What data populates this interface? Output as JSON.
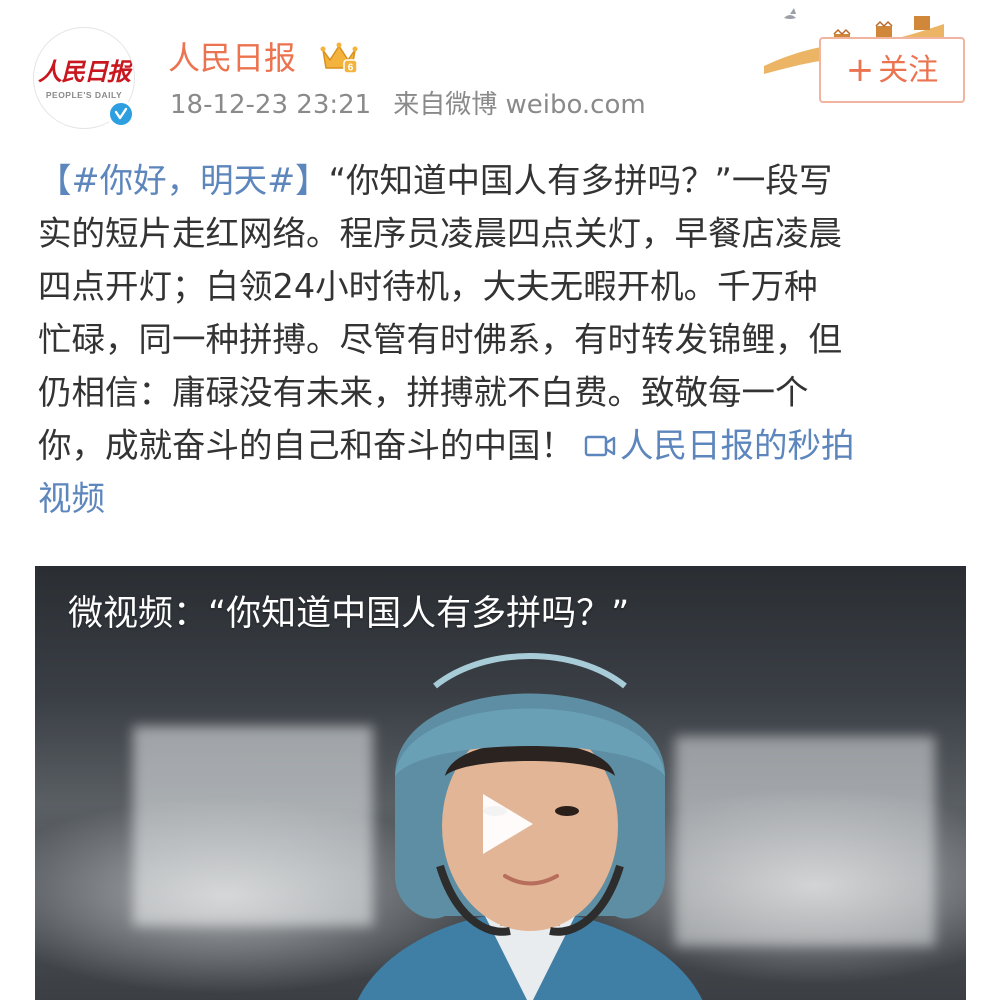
{
  "account": {
    "name": "人民日报",
    "avatar_logo_cn": "人民日报",
    "avatar_logo_en": "PEOPLE'S DAILY",
    "verified": true,
    "verified_color": "#2d9ee0",
    "member_icon": "crown-icon"
  },
  "post_meta": {
    "timestamp": "18-12-23 23:21",
    "source": "来自微博 weibo.com"
  },
  "follow_button": {
    "plus": "+",
    "label": "关注"
  },
  "post": {
    "hashtag": "【#你好，明天#】",
    "lines": [
      "“你知道中国人有多拼吗？”一段写",
      "实的短片走红网络。程序员凌晨四点关灯，早餐店凌晨",
      "四点开灯；白领24小时待机，大夫无暇开机。千万种",
      "忙碌，同一种拼搏。尽管有时佛系，有时转发锦鲤，但",
      "仍相信：庸碌没有未来，拼搏就不白费。致敬每一个",
      "你，成就奋斗的自己和奋斗的中国！"
    ],
    "video_link_part1": "人民日报的秒拍",
    "video_link_part2": "视频"
  },
  "video": {
    "title": "微视频：“你知道中国人有多拼吗？”",
    "play_icon": "play-icon"
  },
  "colors": {
    "username": "#eb7350",
    "link": "#5d86bd",
    "text": "#333333",
    "meta": "#8a8a8a"
  }
}
